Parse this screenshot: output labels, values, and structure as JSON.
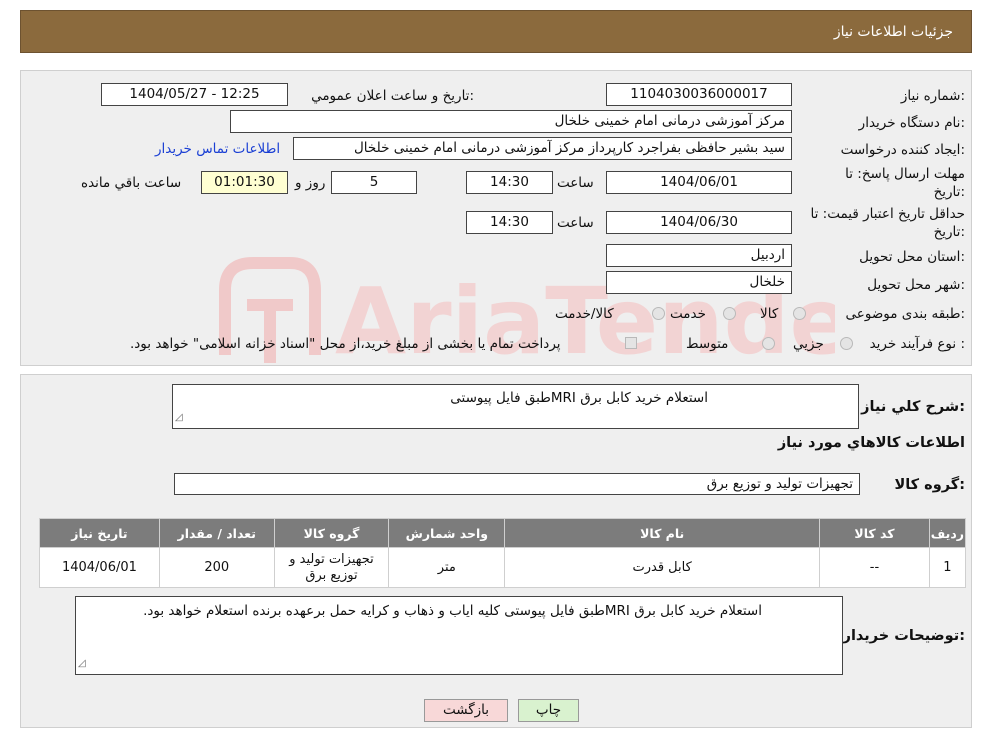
{
  "page": {
    "title": "جزئیات اطلاعات نیاز"
  },
  "watermark": "AriaTender.neT",
  "form": {
    "need_number_label": "شماره نیاز:",
    "need_number": "1104030036000017",
    "announce_label": "تاریخ و ساعت اعلان عمومي:",
    "announce_value": "1404/05/27 - 12:25",
    "buyer_org_label": "نام دستگاه خریدار:",
    "buyer_org": "مرکز آموزشی درمانی امام خمینی خلخال",
    "requester_label": "ایجاد کننده درخواست:",
    "requester": "سید بشیر حافظی بفراجرد کارپرداز مرکز آموزشی درمانی امام خمینی خلخال",
    "contact_link": "اطلاعات تماس خریدار",
    "deadline_label_1": "مهلت ارسال پاسخ: تا",
    "deadline_label_2": "تاریخ:",
    "deadline_date": "1404/06/01",
    "time_label": "ساعت",
    "deadline_time": "14:30",
    "days_value": "5",
    "days_label": "روز و",
    "remaining_time": "01:01:30",
    "remaining_label": "ساعت باقي مانده",
    "validity_label_1": "حداقل تاریخ اعتبار قیمت: تا",
    "validity_label_2": "تاریخ:",
    "validity_date": "1404/06/30",
    "validity_time_label": "ساعت",
    "validity_time": "14:30",
    "province_label": "استان محل تحویل:",
    "province": "اردبیل",
    "city_label": "شهر محل تحویل:",
    "city": "خلخال",
    "category_label": "طبقه بندی موضوعی:",
    "category_options": [
      "کالا",
      "خدمت",
      "کالا/خدمت"
    ],
    "process_label": "نوع فرآیند خرید :",
    "process_options": [
      "جزیي",
      "متوسط"
    ],
    "payment_note": "پرداخت تمام یا بخشی از مبلغ خرید،از محل \"اسناد خزانه اسلامی\" خواهد بود."
  },
  "details": {
    "summary_label": "شرح کلي نیاز:",
    "summary_text": "استعلام خرید کابل برق MRIطبق فایل پیوستی",
    "goods_info_title": "اطلاعات کالاهاي مورد نیاز",
    "goods_group_label": "گروه کالا:",
    "goods_group": "تجهیزات تولید و توزیع برق",
    "table": {
      "headers": [
        "ردیف",
        "کد کالا",
        "نام کالا",
        "واحد شمارش",
        "گروه کالا",
        "تعداد / مقدار",
        "تاریخ نیاز"
      ],
      "rows": [
        [
          "1",
          "--",
          "کابل قدرت",
          "متر",
          "تجهیزات تولید و توزیع برق",
          "200",
          "1404/06/01"
        ]
      ]
    },
    "buyer_notes_label": "توضیحات خریدار:",
    "buyer_notes": "استعلام خرید کابل برق MRIطبق فایل پیوستی کلیه ایاب و ذهاب و کرایه حمل برعهده برنده استعلام خواهد بود."
  },
  "buttons": {
    "print": "چاپ",
    "back": "بازگشت"
  },
  "colors": {
    "header_bg": "#8b6a3d",
    "table_header_bg": "#7c7c7c",
    "link": "#1a3fd4",
    "print_btn": "#d9f2cf",
    "back_btn": "#f8d8d8"
  }
}
